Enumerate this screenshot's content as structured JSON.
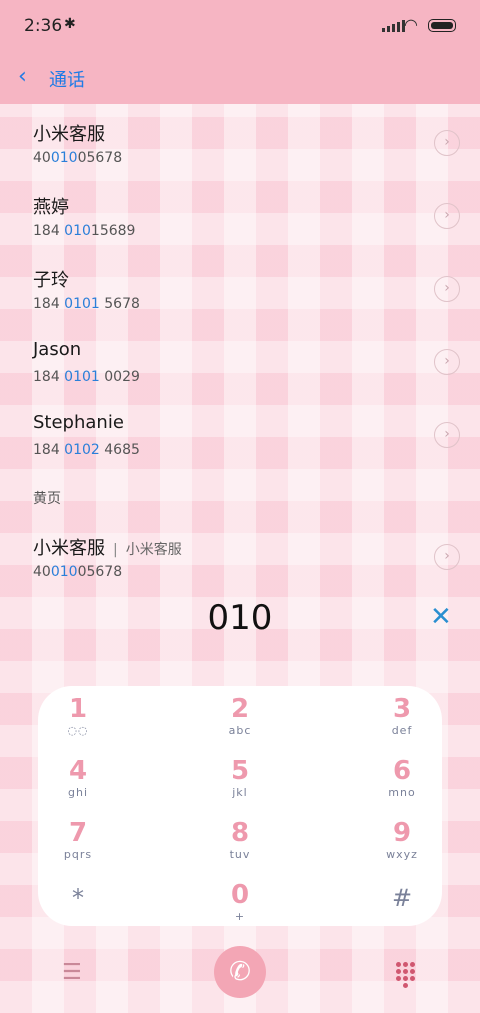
{
  "status": {
    "time": "2:36"
  },
  "header": {
    "title": "通话"
  },
  "contacts": [
    {
      "name": "小米客服",
      "num_pre": "40",
      "num_hl": "010",
      "num_post": "05678"
    },
    {
      "name": "燕婷",
      "num_pre": "184 ",
      "num_hl": "010",
      "num_post": "15689"
    },
    {
      "name": "子玲",
      "num_pre": "184 ",
      "num_hl": "0101",
      "num_post": " 5678"
    },
    {
      "name": "Jason",
      "num_pre": "184 ",
      "num_hl": "0101",
      "num_post": " 0029"
    },
    {
      "name": "Stephanie",
      "num_pre": "184 ",
      "num_hl": "0102",
      "num_post": " 4685"
    }
  ],
  "yellow_pages": {
    "section_label": "黄页",
    "item": {
      "name": "小米客服",
      "separator": "|",
      "subtitle": "小米客服",
      "num_pre": "40",
      "num_hl": "010",
      "num_post": "05678"
    }
  },
  "dialer": {
    "digits": "010"
  },
  "keypad": [
    {
      "digit": "1",
      "letters": "◌◌"
    },
    {
      "digit": "2",
      "letters": "abc"
    },
    {
      "digit": "3",
      "letters": "def"
    },
    {
      "digit": "4",
      "letters": "ghi"
    },
    {
      "digit": "5",
      "letters": "jkl"
    },
    {
      "digit": "6",
      "letters": "mno"
    },
    {
      "digit": "7",
      "letters": "pqrs"
    },
    {
      "digit": "8",
      "letters": "tuv"
    },
    {
      "digit": "9",
      "letters": "wxyz"
    },
    {
      "digit": "*",
      "letters": ""
    },
    {
      "digit": "0",
      "letters": "+"
    },
    {
      "digit": "#",
      "letters": ""
    }
  ],
  "icons": {
    "back": "chevron-left-icon",
    "clear": "close-icon",
    "menu": "menu-icon",
    "call": "phone-icon",
    "keypad_toggle": "dialpad-icon"
  }
}
